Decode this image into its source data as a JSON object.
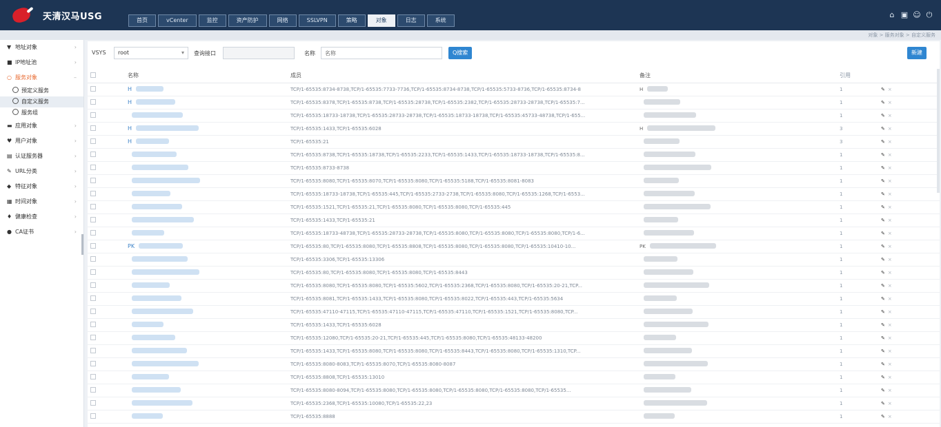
{
  "app": {
    "title": "天清汉马USG"
  },
  "nav": {
    "tabs": [
      "首页",
      "vCenter",
      "监控",
      "资产防护",
      "网络",
      "SSLVPN",
      "策略",
      "对象",
      "日志",
      "系统"
    ],
    "active_index": 7
  },
  "top_icons": [
    "home-icon",
    "save-icon",
    "user-icon",
    "logout-icon"
  ],
  "breadcrumb": "对象 > 服务对象 > 自定义服务",
  "sidebar": {
    "items": [
      {
        "icon": "funnel-icon",
        "label": "地址对象",
        "expanded": false
      },
      {
        "icon": "folder-icon",
        "label": "IP地址池",
        "expanded": false
      },
      {
        "icon": "globe-icon",
        "label": "服务对象",
        "expanded": true
      },
      {
        "icon": "app-icon",
        "label": "应用对象",
        "expanded": false
      },
      {
        "icon": "user-icon",
        "label": "用户对象",
        "expanded": false
      },
      {
        "icon": "server-icon",
        "label": "认证服务器",
        "expanded": false
      },
      {
        "icon": "link-icon",
        "label": "URL分类",
        "expanded": false
      },
      {
        "icon": "tag-icon",
        "label": "特征对象",
        "expanded": false
      },
      {
        "icon": "clock-icon",
        "label": "时间对象",
        "expanded": false
      },
      {
        "icon": "shield-icon",
        "label": "健康检查",
        "expanded": false
      },
      {
        "icon": "cert-icon",
        "label": "CA证书",
        "expanded": false
      }
    ],
    "sub_items": [
      {
        "label": "预定义服务",
        "active": false
      },
      {
        "label": "自定义服务",
        "active": true
      },
      {
        "label": "服务组",
        "active": false
      }
    ]
  },
  "filter": {
    "vsys_label": "VSYS",
    "vsys_value": "root",
    "interface_label": "查询接口",
    "interface_placeholder": "",
    "name_label": "名称",
    "name_placeholder": "名称",
    "search_button": "Q搜索",
    "new_button": "新建"
  },
  "table": {
    "columns": [
      "名称",
      "成员",
      "备注",
      "引用"
    ],
    "rows": [
      {
        "name": "H",
        "members": "TCP/1-65535:8734-8738,TCP/1-65535:7733-7736,TCP/1-65535:8734-8738,TCP/1-65535:5733-8736,TCP/1-65535:8734-8",
        "remark": "H",
        "count": "1"
      },
      {
        "name": "H",
        "members": "TCP/1-65535:8378,TCP/1-65535:8738,TCP/1-65535:28738,TCP/1-65535:2382,TCP/1-65535:28733-28738,TCP/1-65535:7...",
        "remark": "",
        "count": "1"
      },
      {
        "name": "",
        "members": "TCP/1-65535:18733-18738,TCP/1-65535:28733-28738,TCP/1-65535:18733-18738,TCP/1-65535:45733-48738,TCP/1-655...",
        "remark": "",
        "count": "1"
      },
      {
        "name": "H",
        "members": "TCP/1-65535:1433,TCP/1-65535:6028",
        "remark": "H",
        "count": "3"
      },
      {
        "name": "H",
        "members": "TCP/1-65535:21",
        "remark": "",
        "count": "3"
      },
      {
        "name": "",
        "members": "TCP/1-65535:8738,TCP/1-65535:18738,TCP/1-65535:2233,TCP/1-65535:1433,TCP/1-65535:18733-18738,TCP/1-65535:8...",
        "remark": "",
        "count": "1"
      },
      {
        "name": "",
        "members": "TCP/1-65535:8733-8738",
        "remark": "",
        "count": "1"
      },
      {
        "name": "",
        "members": "TCP/1-65535:8080,TCP/1-65535:8070,TCP/1-65535:8080,TCP/1-65535:5188,TCP/1-65535:8081-8083",
        "remark": "",
        "count": "1"
      },
      {
        "name": "",
        "members": "TCP/1-65535:18733-18738,TCP/1-65535:445,TCP/1-65535:2733-2738,TCP/1-65535:8080,TCP/1-65535:1268,TCP/1-6553...",
        "remark": "",
        "count": "1"
      },
      {
        "name": "",
        "members": "TCP/1-65535:1521,TCP/1-65535:21,TCP/1-65535:8080,TCP/1-65535:8080,TCP/1-65535:445",
        "remark": "",
        "count": "1"
      },
      {
        "name": "",
        "members": "TCP/1-65535:1433,TCP/1-65535:21",
        "remark": "",
        "count": "1"
      },
      {
        "name": "",
        "members": "TCP/1-65535:18733-48738,TCP/1-65535:28733-28738,TCP/1-65535:8080,TCP/1-65535:8080,TCP/1-65535:8080,TCP/1-6...",
        "remark": "",
        "count": "1"
      },
      {
        "name": "PK",
        "members": "TCP/1-65535:80,TCP/1-65535:8080,TCP/1-65535:8808,TCP/1-65535:8080,TCP/1-65535:8080,TCP/1-65535:10410-10...",
        "remark": "PK",
        "count": "1"
      },
      {
        "name": "",
        "members": "TCP/1-65535:3306,TCP/1-65535:13306",
        "remark": "",
        "count": "1"
      },
      {
        "name": "",
        "members": "TCP/1-65535:80,TCP/1-65535:8080,TCP/1-65535:8080,TCP/1-65535:8443",
        "remark": "",
        "count": "1"
      },
      {
        "name": "",
        "members": "TCP/1-65535:8080,TCP/1-65535:8080,TCP/1-65535:5602,TCP/1-65535:2368,TCP/1-65535:8080,TCP/1-65535:20-21,TCP...",
        "remark": "",
        "count": "1"
      },
      {
        "name": "",
        "members": "TCP/1-65535:8081,TCP/1-65535:1433,TCP/1-65535:8080,TCP/1-65535:8022,TCP/1-65535:443,TCP/1-65535:5634",
        "remark": "",
        "count": "1"
      },
      {
        "name": "",
        "members": "TCP/1-65535:47110-47115,TCP/1-65535:47110-47115,TCP/1-65535:47110,TCP/1-65535:1521,TCP/1-65535:8080,TCP...",
        "remark": "",
        "count": "1"
      },
      {
        "name": "",
        "members": "TCP/1-65535:1433,TCP/1-65535:6028",
        "remark": "",
        "count": "1"
      },
      {
        "name": "",
        "members": "TCP/1-65535:12080,TCP/1-65535:20-21,TCP/1-65535:445,TCP/1-65535:8080,TCP/1-65535:48133-48200",
        "remark": "",
        "count": "1"
      },
      {
        "name": "",
        "members": "TCP/1-65535:1433,TCP/1-65535:8080,TCP/1-65535:8080,TCP/1-65535:8443,TCP/1-65535:8080,TCP/1-65535:1310,TCP...",
        "remark": "",
        "count": "1"
      },
      {
        "name": "",
        "members": "TCP/1-65535:8080-8083,TCP/1-65535:8070,TCP/1-65535:8080-8087",
        "remark": "",
        "count": "1"
      },
      {
        "name": "",
        "members": "TCP/1-65535:8808,TCP/1-65535:13010",
        "remark": "",
        "count": "1"
      },
      {
        "name": "",
        "members": "TCP/1-65535:8080-8094,TCP/1-65535:8080,TCP/1-65535:8080,TCP/1-65535:8080,TCP/1-65535:8080,TCP/1-65535...",
        "remark": "",
        "count": "1"
      },
      {
        "name": "",
        "members": "TCP/1-65535:2368,TCP/1-65535:10080,TCP/1-65535:22,23",
        "remark": "",
        "count": "1"
      },
      {
        "name": "",
        "members": "TCP/1-65535:8888",
        "remark": "",
        "count": "1"
      }
    ]
  },
  "ops": {
    "edit_icon": "✎",
    "delete_icon": "×"
  },
  "colors": {
    "topbar": "#1d3554",
    "accent": "#2f86d1",
    "active_menu": "#e86a30"
  }
}
